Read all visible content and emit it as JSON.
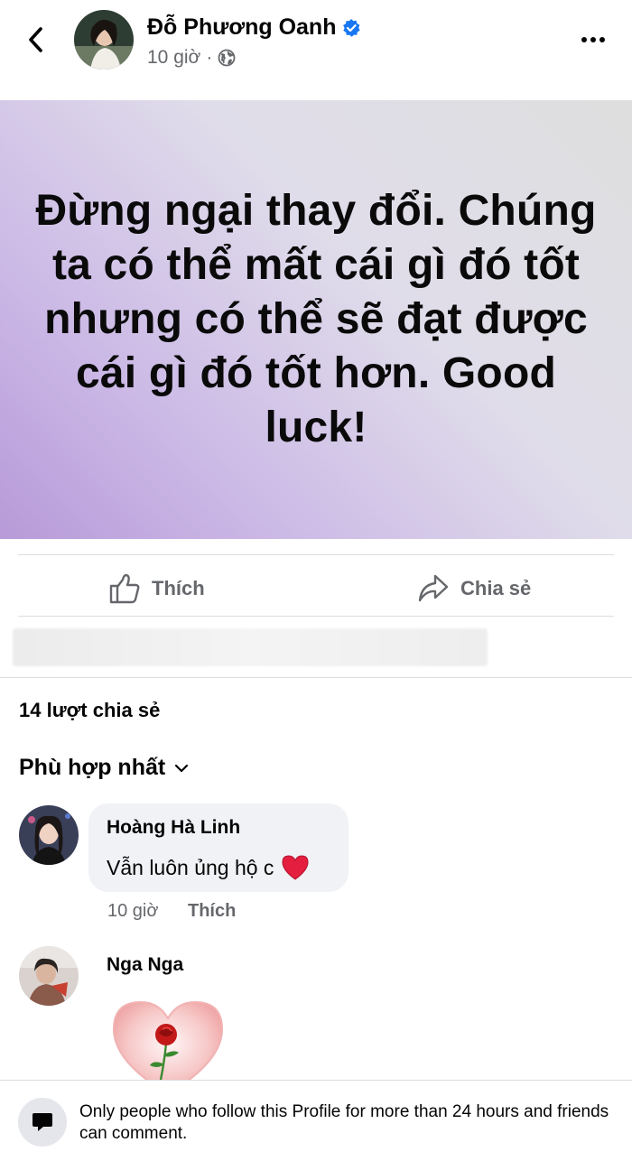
{
  "header": {
    "author": "Đỗ Phương Oanh",
    "time": "10 giờ",
    "separator": "·"
  },
  "post": {
    "text": "Đừng ngại thay đổi. Chúng ta có thể mất cái gì đó tốt nhưng có thể sẽ đạt được cái gì đó tốt hơn. Good luck!"
  },
  "actions": {
    "like_label": "Thích",
    "share_label": "Chia sẻ"
  },
  "stats": {
    "shares": "14 lượt chia sẻ"
  },
  "sort": {
    "label": "Phù hợp nhất"
  },
  "comments": [
    {
      "name": "Hoàng Hà Linh",
      "text": "Vẫn luôn ủng hộ c",
      "time": "10 giờ",
      "like": "Thích"
    },
    {
      "name": "Nga Nga"
    }
  ],
  "footer": {
    "notice": "Only people who follow this Profile for more than 24 hours and friends can comment."
  },
  "colors": {
    "verified": "#1877f2",
    "secondary_text": "#65676b",
    "bubble": "#f0f2f5"
  }
}
